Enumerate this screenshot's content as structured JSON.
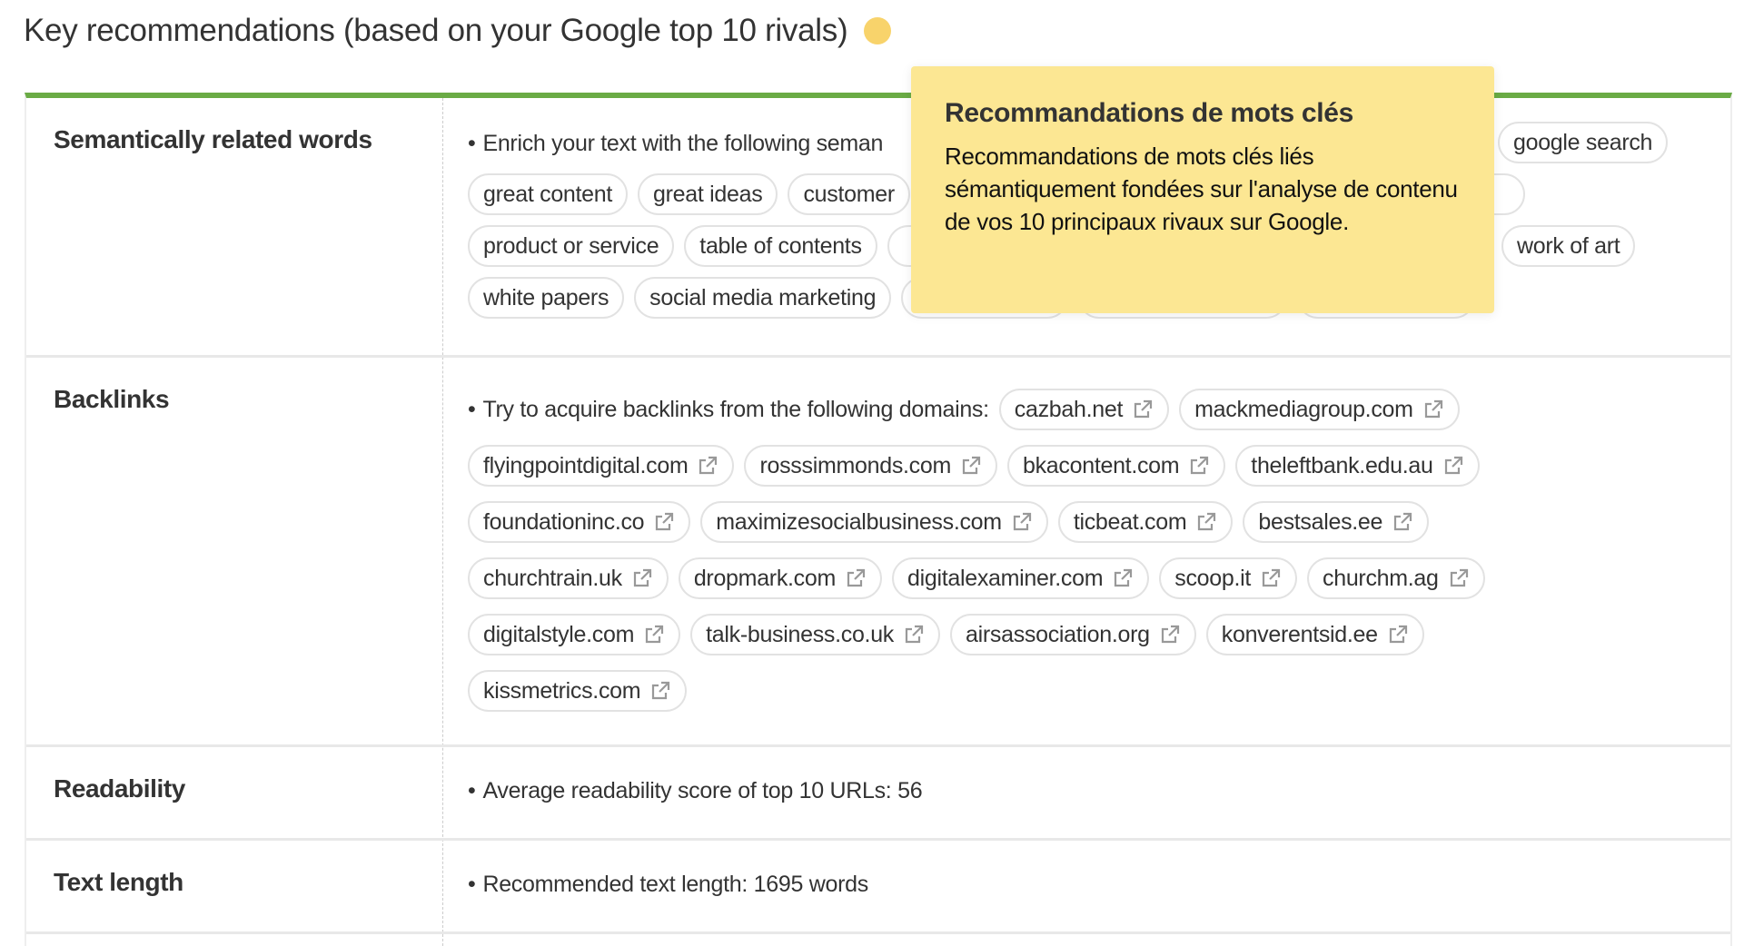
{
  "header": {
    "title": "Key recommendations (based on your Google top 10 rivals)",
    "status_color": "#f8d36b"
  },
  "accent_color": "#6aab45",
  "tooltip": {
    "title": "Recommandations de mots clés",
    "body": "Recommandations de mots clés liés sémantiquement fondées sur l'analyse de contenu de vos 10 principaux rivaux sur Google."
  },
  "semantic": {
    "label": "Semantically related words",
    "intro": "Enrich your text with the following seman",
    "chips": [
      "google search",
      "great content",
      "great ideas",
      "customer",
      "work of art",
      "product or service",
      "table of contents",
      "white papers",
      "social media marketing"
    ]
  },
  "backlinks": {
    "label": "Backlinks",
    "intro": "Try to acquire backlinks from the following domains:",
    "icon": "external-link-icon",
    "domains": [
      "cazbah.net",
      "mackmediagroup.com",
      "flyingpointdigital.com",
      "rosssimmonds.com",
      "bkacontent.com",
      "theleftbank.edu.au",
      "foundationinc.co",
      "maximizesocialbusiness.com",
      "ticbeat.com",
      "bestsales.ee",
      "churchtrain.uk",
      "dropmark.com",
      "digitalexaminer.com",
      "scoop.it",
      "churchm.ag",
      "digitalstyle.com",
      "talk-business.co.uk",
      "airsassociation.org",
      "konverentsid.ee",
      "kissmetrics.com"
    ]
  },
  "readability": {
    "label": "Readability",
    "text": "Average readability score of top 10 URLs:  56"
  },
  "text_length": {
    "label": "Text length",
    "text": "Recommended text length:  1695 words"
  }
}
